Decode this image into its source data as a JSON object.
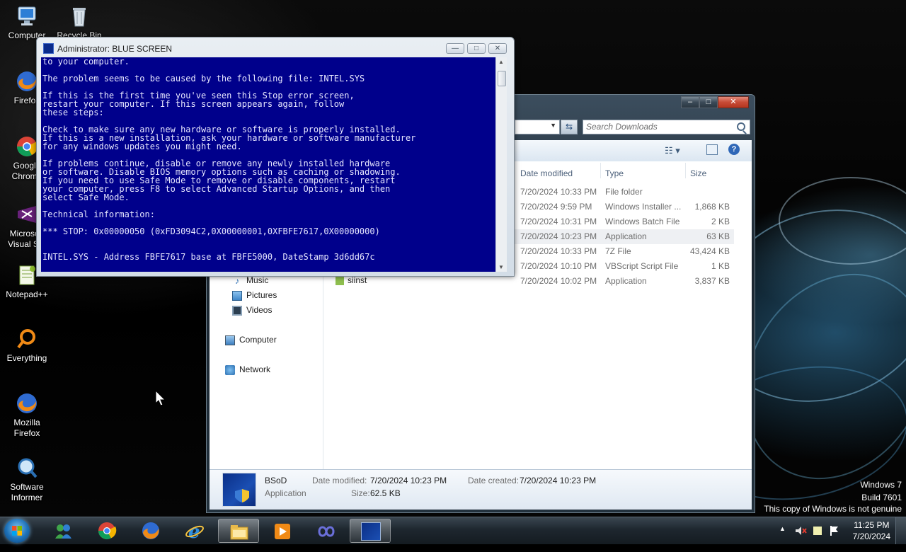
{
  "desktop": {
    "icons": [
      {
        "label": "Computer",
        "icon": "computer-icon"
      },
      {
        "label": "Recycle Bin",
        "icon": "recycle-bin-icon"
      },
      {
        "label": "Firefox",
        "icon": "firefox-icon"
      },
      {
        "label": "Google Chrome",
        "icon": "chrome-icon"
      },
      {
        "label": "Microsoft Visual Stu",
        "icon": "visual-studio-icon"
      },
      {
        "label": "Notepad++",
        "icon": "notepad-plus-plus-icon"
      },
      {
        "label": "Everything",
        "icon": "everything-search-icon"
      },
      {
        "label": "Mozilla Firefox",
        "icon": "firefox-icon"
      },
      {
        "label": "Software Informer",
        "icon": "software-informer-icon"
      }
    ]
  },
  "cmd_window": {
    "title": "Administrator:  BLUE SCREEN",
    "console_lines": [
      "to your computer.",
      "",
      "The problem seems to be caused by the following file: INTEL.SYS",
      "",
      "If this is the first time you've seen this Stop error screen,",
      "restart your computer. If this screen appears again, follow",
      "these steps:",
      "",
      "Check to make sure any new hardware or software is properly installed.",
      "If this is a new installation, ask your hardware or software manufacturer",
      "for any windows updates you might need.",
      "",
      "If problems continue, disable or remove any newly installed hardware",
      "or software. Disable BIOS memory options such as caching or shadowing.",
      "If you need to use Safe Mode to remove or disable components, restart",
      "your computer, press F8 to select Advanced Startup Options, and then",
      "select Safe Mode.",
      "",
      "Technical information:",
      "",
      "*** STOP: 0x00000050 (0xFD3094C2,0X00000001,0XFBFE7617,0X00000000)",
      "",
      "",
      "INTEL.SYS - Address FBFE7617 base at FBFE5000, DateStamp 3d6dd67c"
    ],
    "buttons": {
      "minimize": "—",
      "maximize": "□",
      "close": "✕"
    }
  },
  "explorer": {
    "search_placeholder": "Search Downloads",
    "columns": {
      "date": "Date modified",
      "type": "Type",
      "size": "Size"
    },
    "nav": [
      {
        "label": "Music",
        "icon": "music-library-icon"
      },
      {
        "label": "Pictures",
        "icon": "pictures-library-icon"
      },
      {
        "label": "Videos",
        "icon": "videos-library-icon"
      },
      {
        "label": "Computer",
        "icon": "computer-icon"
      },
      {
        "label": "Network",
        "icon": "network-icon"
      }
    ],
    "rows": [
      {
        "date": "7/20/2024 10:33 PM",
        "type": "File folder",
        "size": ""
      },
      {
        "date": "7/20/2024 9:59 PM",
        "type": "Windows Installer ...",
        "size": "1,868 KB"
      },
      {
        "date": "7/20/2024 10:31 PM",
        "type": "Windows Batch File",
        "size": "2 KB"
      },
      {
        "date": "7/20/2024 10:23 PM",
        "type": "Application",
        "size": "63 KB"
      },
      {
        "date": "7/20/2024 10:33 PM",
        "type": "7Z File",
        "size": "43,424 KB"
      },
      {
        "date": "7/20/2024 10:10 PM",
        "type": "VBScript Script File",
        "size": "1 KB"
      },
      {
        "date": "7/20/2024 10:02 PM",
        "type": "Application",
        "size": "3,837 KB"
      }
    ],
    "partial_name": "siinst",
    "details": {
      "name": "BSoD",
      "kind": "Application",
      "date_modified_label": "Date modified:",
      "date_modified": "7/20/2024 10:23 PM",
      "size_label": "Size:",
      "size": "62.5 KB",
      "date_created_label": "Date created:",
      "date_created": "7/20/2024 10:23 PM"
    }
  },
  "watermark": {
    "line1": "Windows 7",
    "line2": "Build 7601",
    "line3": "This copy of Windows is not genuine"
  },
  "taskbar": {
    "pinned": [
      "windows-live-messenger-icon",
      "chrome-icon",
      "firefox-icon",
      "internet-explorer-icon",
      "explorer-folder-icon",
      "media-player-icon",
      "infinity-app-icon",
      "cmd-bluescreen-thumb-icon"
    ],
    "time": "11:25 PM",
    "date": "7/20/2024"
  },
  "colors": {
    "console_bg": "#00008B",
    "console_text": "#E6E6FF",
    "taskbar": "#1E272F",
    "accent": "#1D71B8"
  }
}
